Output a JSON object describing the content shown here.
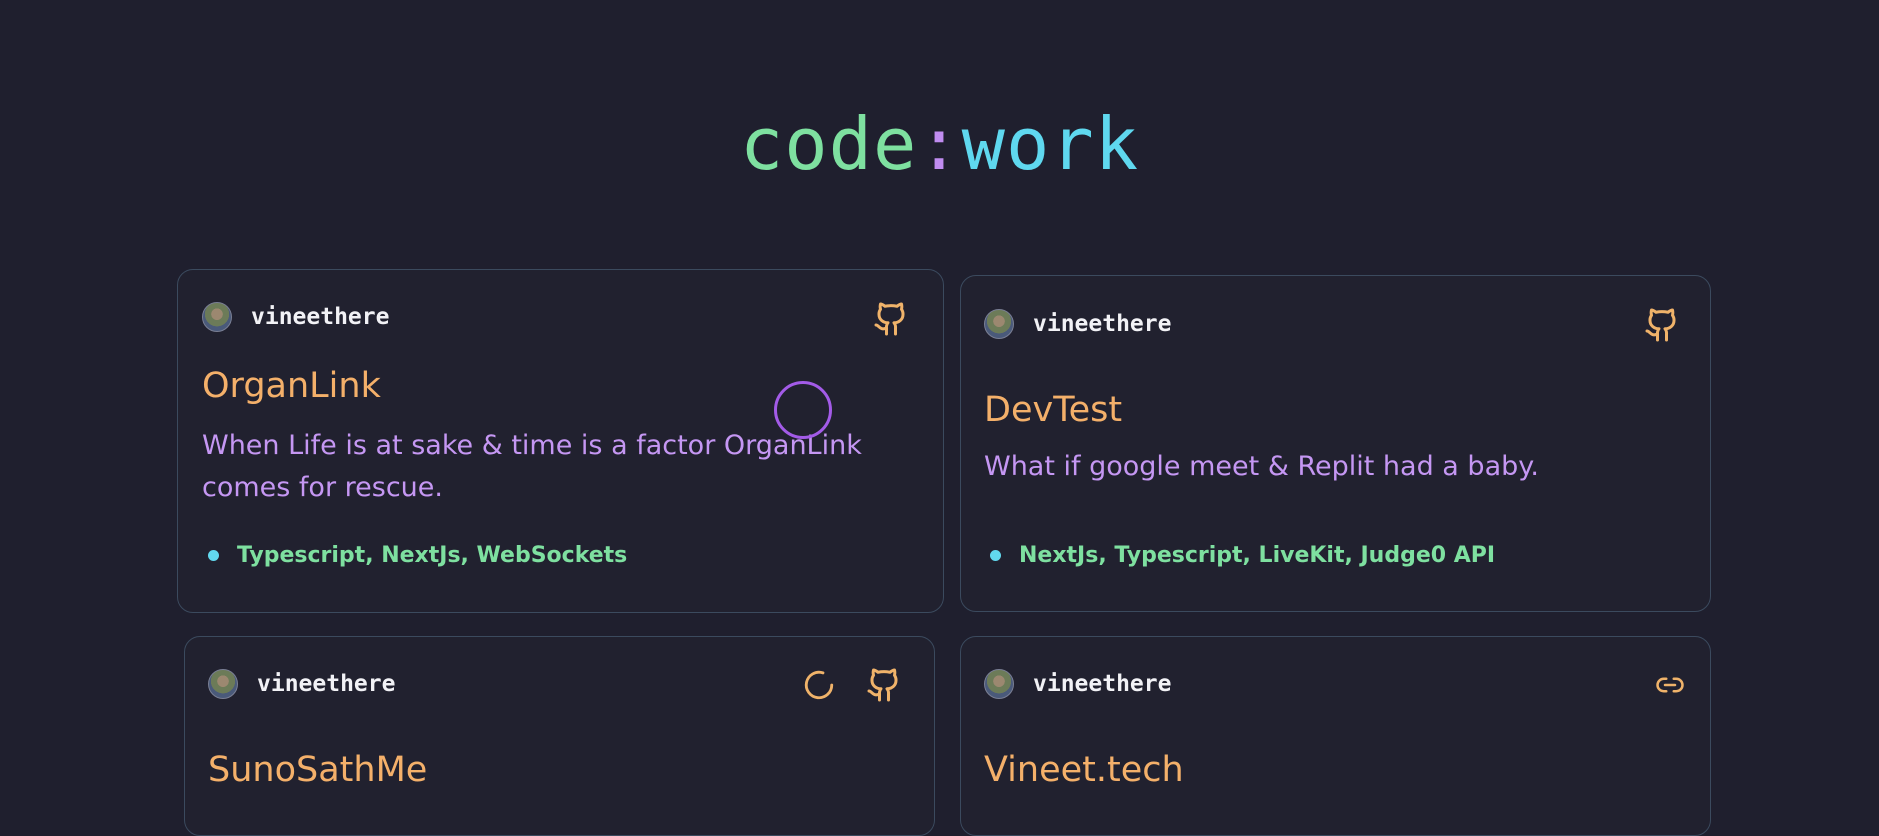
{
  "page": {
    "title_part1": "code",
    "title_part2": ":",
    "title_part3": "work"
  },
  "projects": [
    {
      "author": "vineethere",
      "title": "OrganLink",
      "description": "When Life is at sake & time is a factor OrganLink comes for rescue.",
      "tech": "Typescript, NextJs, WebSockets",
      "icons": [
        "github-icon"
      ]
    },
    {
      "author": "vineethere",
      "title": "DevTest",
      "description": "What if google meet & Replit had a baby.",
      "tech": "NextJs, Typescript, LiveKit, Judge0 API",
      "icons": [
        "github-icon"
      ]
    },
    {
      "author": "vineethere",
      "title": "SunoSathMe",
      "description": "",
      "tech": "",
      "icons": [
        "loading-spinner-icon",
        "github-icon"
      ]
    },
    {
      "author": "vineethere",
      "title": "Vineet.tech",
      "description": "",
      "tech": "",
      "icons": [
        "link-icon"
      ]
    }
  ],
  "colors": {
    "background": "#1f1f2e",
    "card_border": "#3b4a5e",
    "accent_orange": "#f4b06a",
    "accent_purple": "#c597f3",
    "accent_green": "#7ee0a0",
    "accent_cyan": "#62d9ef"
  }
}
